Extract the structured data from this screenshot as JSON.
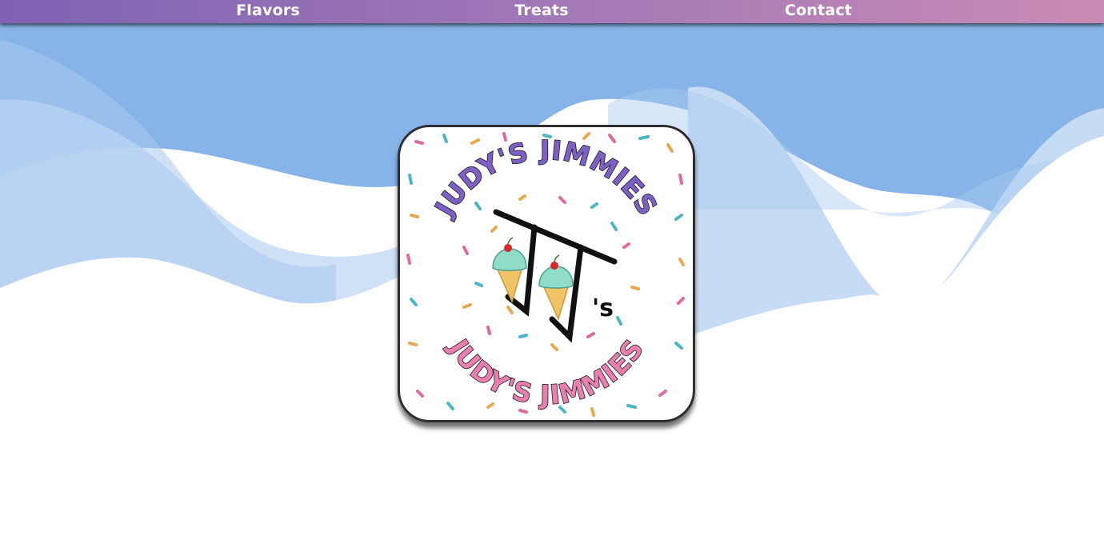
{
  "nav": {
    "items": [
      {
        "label": "Flavors"
      },
      {
        "label": "Treats"
      },
      {
        "label": "Contact"
      }
    ]
  },
  "colors": {
    "nav_gradient": [
      "#7f62b4",
      "#a278b6",
      "#c98bb5"
    ],
    "sky_blue": "#86b4e8",
    "wave_light": "#c5dcf4",
    "logo_purple": "#7e5fc4",
    "logo_pink": "#e87fae"
  },
  "logo": {
    "top_text": "JUDY'S JIMMIES",
    "bottom_text": "JUDY'S JIMMIES",
    "monogram_suffix": "'s",
    "icons": [
      "ice-cream-cone-icon",
      "ice-cream-cone-icon"
    ]
  }
}
